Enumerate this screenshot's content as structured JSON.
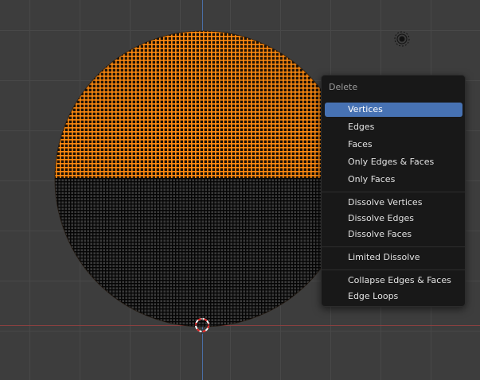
{
  "viewport": {
    "selected_color": "#ff8000",
    "unselected_color": "#000000",
    "background_color": "#3d3d3d"
  },
  "delete_menu": {
    "title": "Delete",
    "highlight_color": "#4772b3",
    "items": [
      {
        "label": "Vertices",
        "active": true
      },
      {
        "label": "Edges",
        "active": false
      },
      {
        "label": "Faces",
        "active": false
      },
      {
        "label": "Only Edges & Faces",
        "active": false
      },
      {
        "label": "Only Faces",
        "active": false
      },
      {
        "label": "Dissolve Vertices",
        "active": false
      },
      {
        "label": "Dissolve Edges",
        "active": false
      },
      {
        "label": "Dissolve Faces",
        "active": false
      },
      {
        "label": "Limited Dissolve",
        "active": false
      },
      {
        "label": "Collapse Edges & Faces",
        "active": false
      },
      {
        "label": "Edge Loops",
        "active": false
      }
    ]
  },
  "icons": {
    "light": "light-icon",
    "cursor": "3d-cursor-icon"
  }
}
